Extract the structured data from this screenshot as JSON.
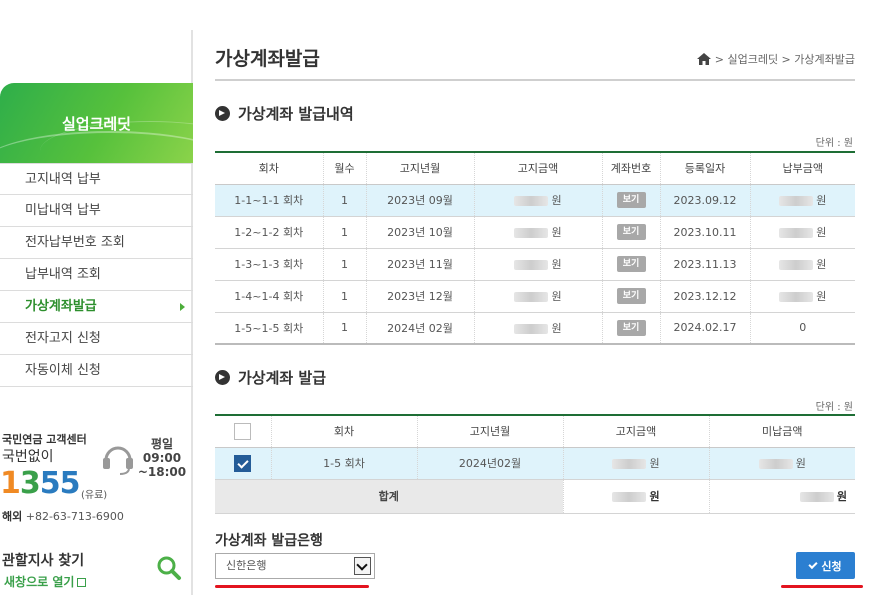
{
  "sidebar": {
    "brand_title": "실업크레딧",
    "menu": [
      {
        "label": "고지내역 납부"
      },
      {
        "label": "미납내역 납부"
      },
      {
        "label": "전자납부번호 조회"
      },
      {
        "label": "납부내역 조회"
      },
      {
        "label": "가상계좌발급",
        "active": true
      },
      {
        "label": "전자고지 신청"
      },
      {
        "label": "자동이체 신청"
      }
    ],
    "customer_center": {
      "name": "국민연금 고객센터",
      "sub": "국번없이",
      "number_digits": [
        "1",
        "3",
        "5",
        "5"
      ],
      "paid_note": "(유료)",
      "overseas_label": "해외",
      "overseas_number": "+82-63-713-6900",
      "hours_label": "평일",
      "hours_from": "09:00",
      "hours_to": "~18:00",
      "icon": "headset-icon"
    },
    "branch": {
      "title": "관할지사 찾기",
      "link": "새창으로 열기",
      "icon": "search-icon"
    }
  },
  "main": {
    "page_title": "가상계좌발급",
    "breadcrumb": {
      "home_icon": "home-icon",
      "path": "> 실업크레딧 > 가상계좌발급"
    },
    "history": {
      "title": "가상계좌 발급내역",
      "unit": "단위 : 원",
      "headers": [
        "회차",
        "월수",
        "고지년월",
        "고지금액",
        "계좌번호",
        "등록일자",
        "납부금액"
      ],
      "view_label": "보기",
      "won": "원",
      "rows": [
        {
          "round": "1-1~1-1 회차",
          "months": "1",
          "ym": "2023년 09월",
          "date": "2023.09.12",
          "paid": "원",
          "highlight": true
        },
        {
          "round": "1-2~1-2 회차",
          "months": "1",
          "ym": "2023년 10월",
          "date": "2023.10.11",
          "paid": "원"
        },
        {
          "round": "1-3~1-3 회차",
          "months": "1",
          "ym": "2023년 11월",
          "date": "2023.11.13",
          "paid": "원"
        },
        {
          "round": "1-4~1-4 회차",
          "months": "1",
          "ym": "2023년 12월",
          "date": "2023.12.12",
          "paid": "원"
        },
        {
          "round": "1-5~1-5 회차",
          "months": "1",
          "ym": "2024년 02월",
          "date": "2024.02.17",
          "paid": "0"
        }
      ]
    },
    "issue": {
      "title": "가상계좌 발급",
      "unit": "단위 : 원",
      "headers": [
        "회차",
        "고지년월",
        "고지금액",
        "미납금액"
      ],
      "row": {
        "round": "1-5 회차",
        "ym": "2024년02월",
        "amount_suffix": "원",
        "unpaid_suffix": "원",
        "checked": true
      },
      "sum_label": "합계",
      "sum_amount_suffix": "원",
      "sum_unpaid_suffix": "원"
    },
    "bank": {
      "title": "가상계좌 발급은행",
      "selected": "신한은행",
      "apply_label": "신청"
    },
    "colors": {
      "brand_green": "#3fb444",
      "table_border": "#1e6e35",
      "highlight_row": "#dff3fb",
      "apply_blue": "#2b7fd1",
      "underline_red": "#e3141f"
    }
  }
}
